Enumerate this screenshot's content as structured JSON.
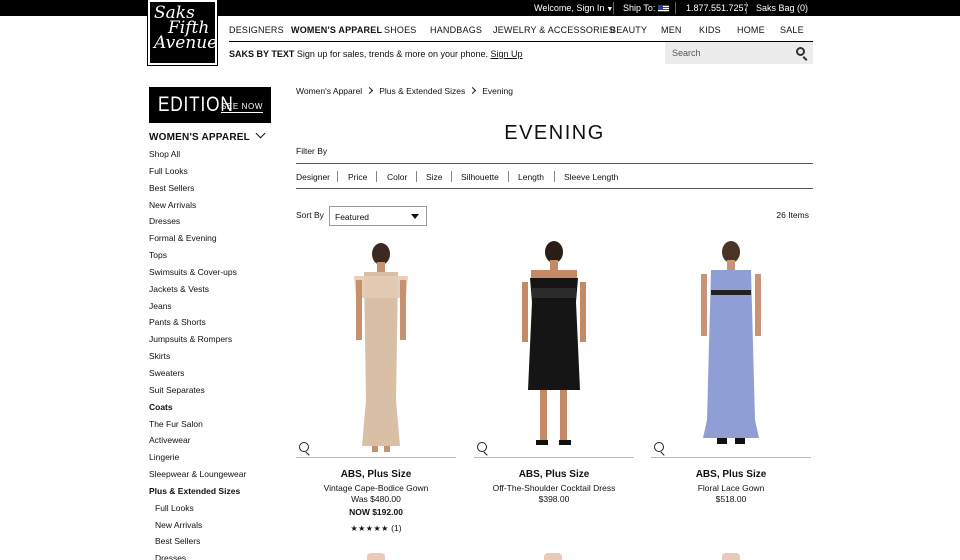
{
  "topbar": {
    "welcome": "Welcome, Sign In",
    "ship_to": "Ship To:",
    "phone": "1.877.551.7257",
    "bag": "Saks Bag (0)"
  },
  "logo": {
    "line1": "Saks",
    "line2": "Fifth",
    "line3": "Avenue"
  },
  "nav": {
    "items": [
      "DESIGNERS",
      "WOMEN'S APPAREL",
      "SHOES",
      "HANDBAGS",
      "JEWELRY & ACCESSORIES",
      "BEAUTY",
      "MEN",
      "KIDS",
      "HOME",
      "SALE"
    ],
    "active": "WOMEN'S APPAREL"
  },
  "promo": {
    "bold": "SAKS BY TEXT",
    "text": "Sign up for sales, trends & more on your phone.",
    "link": "Sign Up"
  },
  "search": {
    "placeholder": "Search"
  },
  "banner": {
    "title": "EDITION",
    "cta": "SEE NOW"
  },
  "sidebar": {
    "heading": "WOMEN'S APPAREL",
    "items": [
      {
        "label": "Shop All"
      },
      {
        "label": "Full Looks"
      },
      {
        "label": "Best Sellers"
      },
      {
        "label": "New Arrivals"
      },
      {
        "label": "Dresses"
      },
      {
        "label": "Formal & Evening"
      },
      {
        "label": "Tops"
      },
      {
        "label": "Swimsuits & Cover-ups"
      },
      {
        "label": "Jackets & Vests"
      },
      {
        "label": "Jeans"
      },
      {
        "label": "Pants & Shorts"
      },
      {
        "label": "Jumpsuits & Rompers"
      },
      {
        "label": "Skirts"
      },
      {
        "label": "Sweaters"
      },
      {
        "label": "Suit Separates"
      },
      {
        "label": "Coats",
        "strong": true
      },
      {
        "label": "The Fur Salon"
      },
      {
        "label": "Activewear"
      },
      {
        "label": "Lingerie"
      },
      {
        "label": "Sleepwear & Loungewear"
      },
      {
        "label": "Plus & Extended Sizes",
        "strong": true
      },
      {
        "label": "Full Looks",
        "sub": true
      },
      {
        "label": "New Arrivals",
        "sub": true
      },
      {
        "label": "Best Sellers",
        "sub": true
      },
      {
        "label": "Dresses",
        "sub": true
      }
    ]
  },
  "breadcrumb": [
    "Women's Apparel",
    "Plus & Extended Sizes",
    "Evening"
  ],
  "page_title": "EVENING",
  "filters": {
    "label": "Filter By",
    "items": [
      "Designer",
      "Price",
      "Color",
      "Size",
      "Silhouette",
      "Length",
      "Sleeve Length"
    ]
  },
  "sort": {
    "label": "Sort By",
    "selected": "Featured"
  },
  "item_count": "26 Items",
  "products": [
    {
      "brand": "ABS, Plus Size",
      "name": "Vintage Cape-Bodice Gown",
      "price": "Was $480.00",
      "now": "NOW $192.00",
      "stars": "★★★★★",
      "reviews": "(1)",
      "dress_color": "#d9bfa6"
    },
    {
      "brand": "ABS, Plus Size",
      "name": "Off-The-Shoulder Cocktail Dress",
      "price": "$398.00",
      "dress_color": "#151515"
    },
    {
      "brand": "ABS, Plus Size",
      "name": "Floral Lace Gown",
      "price": "$518.00",
      "dress_color": "#8f9fd6"
    }
  ]
}
